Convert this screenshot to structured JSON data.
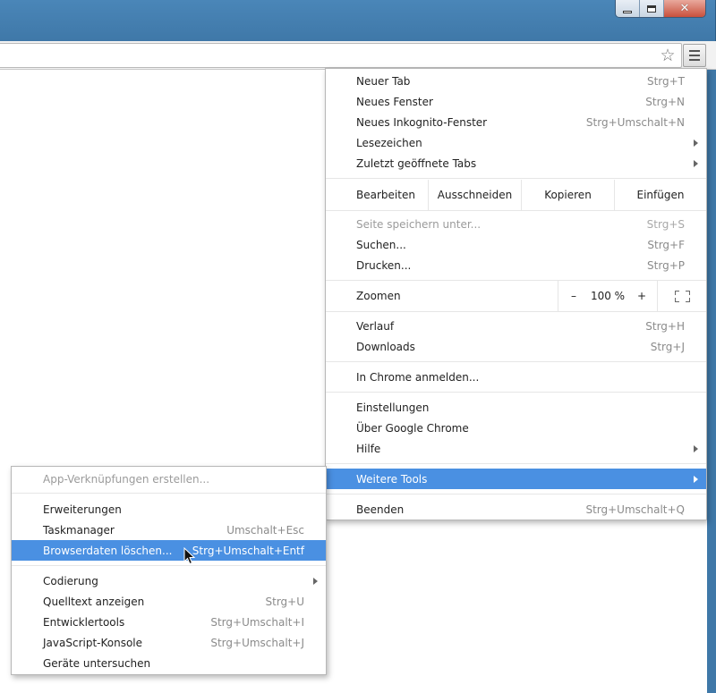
{
  "window": {
    "minimize_glyph": "",
    "close_glyph": "✕"
  },
  "toolbar": {
    "bookmark_star": "☆"
  },
  "main_menu": {
    "items_top": [
      {
        "label": "Neuer Tab",
        "shortcut": "Strg+T"
      },
      {
        "label": "Neues Fenster",
        "shortcut": "Strg+N"
      },
      {
        "label": "Neues Inkognito-Fenster",
        "shortcut": "Strg+Umschalt+N"
      },
      {
        "label": "Lesezeichen",
        "shortcut": ""
      },
      {
        "label": "Zuletzt geöffnete Tabs",
        "shortcut": ""
      }
    ],
    "edit": {
      "label": "Bearbeiten",
      "cut": "Ausschneiden",
      "copy": "Kopieren",
      "paste": "Einfügen"
    },
    "items_page": [
      {
        "label": "Seite speichern unter...",
        "shortcut": "Strg+S"
      },
      {
        "label": "Suchen...",
        "shortcut": "Strg+F"
      },
      {
        "label": "Drucken...",
        "shortcut": "Strg+P"
      }
    ],
    "zoom": {
      "label": "Zoomen",
      "minus": "–",
      "value": "100 %",
      "plus": "+"
    },
    "items_history": [
      {
        "label": "Verlauf",
        "shortcut": "Strg+H"
      },
      {
        "label": "Downloads",
        "shortcut": "Strg+J"
      }
    ],
    "signin": {
      "label": "In Chrome anmelden..."
    },
    "items_settings": [
      {
        "label": "Einstellungen"
      },
      {
        "label": "Über Google Chrome"
      },
      {
        "label": "Hilfe"
      }
    ],
    "more_tools": {
      "label": "Weitere Tools"
    },
    "exit": {
      "label": "Beenden",
      "shortcut": "Strg+Umschalt+Q"
    }
  },
  "sub_menu": {
    "app_shortcuts": {
      "label": "App-Verknüpfungen erstellen..."
    },
    "items_a": [
      {
        "label": "Erweiterungen",
        "shortcut": ""
      },
      {
        "label": "Taskmanager",
        "shortcut": "Umschalt+Esc"
      },
      {
        "label": "Browserdaten löschen...",
        "shortcut": "Strg+Umschalt+Entf"
      }
    ],
    "items_b": [
      {
        "label": "Codierung",
        "shortcut": ""
      },
      {
        "label": "Quelltext anzeigen",
        "shortcut": "Strg+U"
      },
      {
        "label": "Entwicklertools",
        "shortcut": "Strg+Umschalt+I"
      },
      {
        "label": "JavaScript-Konsole",
        "shortcut": "Strg+Umschalt+J"
      },
      {
        "label": "Geräte untersuchen",
        "shortcut": ""
      }
    ]
  },
  "colors": {
    "highlight": "#4a90e2",
    "frame": "#3f78a8"
  }
}
